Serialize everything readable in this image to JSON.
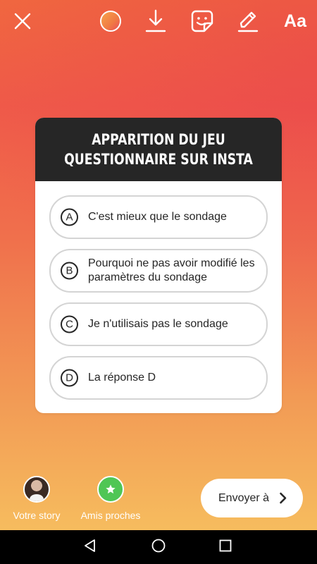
{
  "topbar": {
    "icons": [
      "close-icon",
      "color-picker",
      "download-icon",
      "sticker-icon",
      "draw-icon",
      "text-icon"
    ],
    "text_label": "Aa",
    "color_dot": "#f07a44"
  },
  "quiz": {
    "title": "APPARITION DU JEU\nQUESTIONNAIRE SUR INSTA",
    "options": [
      {
        "letter": "A",
        "text": "C'est mieux que le sondage"
      },
      {
        "letter": "B",
        "text": "Pourquoi ne pas avoir modifié les paramètres du sondage"
      },
      {
        "letter": "C",
        "text": "Je n'utilisais pas le sondage"
      },
      {
        "letter": "D",
        "text": "La réponse D"
      }
    ]
  },
  "bottom": {
    "your_story_label": "Votre story",
    "close_friends_label": "Amis proches",
    "send_label": "Envoyer à"
  },
  "colors": {
    "header_dark": "#262626",
    "close_friends_green": "#4fc655",
    "gradient_top": "#ef5a49",
    "gradient_bottom": "#f6bc5e"
  }
}
